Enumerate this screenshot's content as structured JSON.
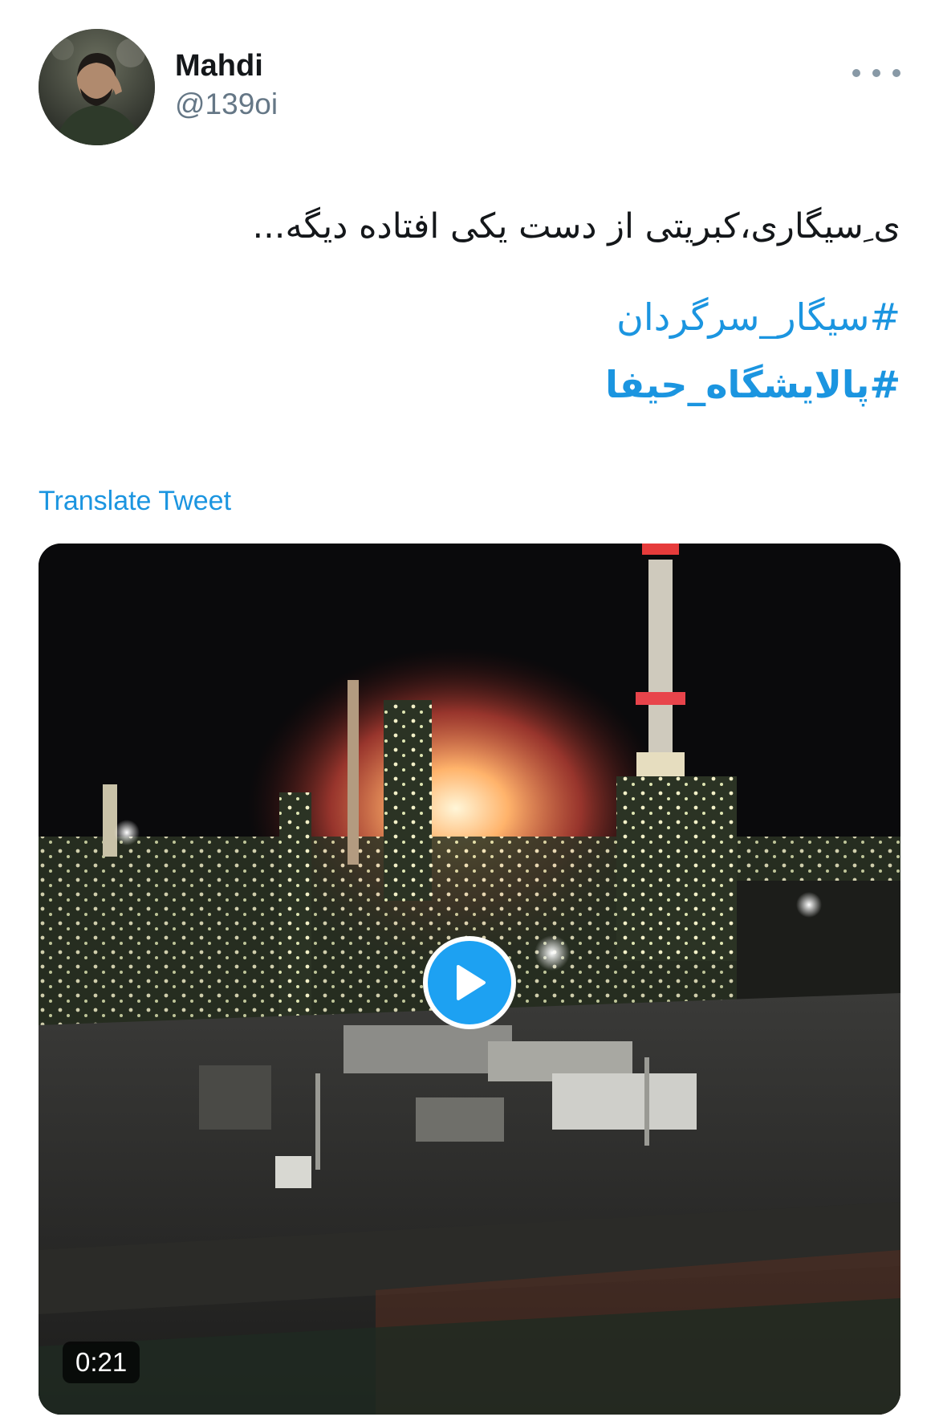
{
  "tweet": {
    "author": {
      "display_name": "Mahdi",
      "handle": "@139oi",
      "avatar_icon": "profile-photo"
    },
    "more_icon": "ellipsis-horizontal-icon",
    "text": "ی ِسیگاری،کبریتی از دست یکی افتاده دیگه...",
    "hashtags": [
      "#سیگار_سرگردان",
      "#پالایشگاه_حیفا"
    ],
    "translate_label": "Translate Tweet",
    "video": {
      "duration": "0:21",
      "play_icon": "play-icon"
    }
  },
  "colors": {
    "link": "#1b95e0",
    "text": "#14171a",
    "secondary": "#657786",
    "play_button": "#1da1f2"
  }
}
